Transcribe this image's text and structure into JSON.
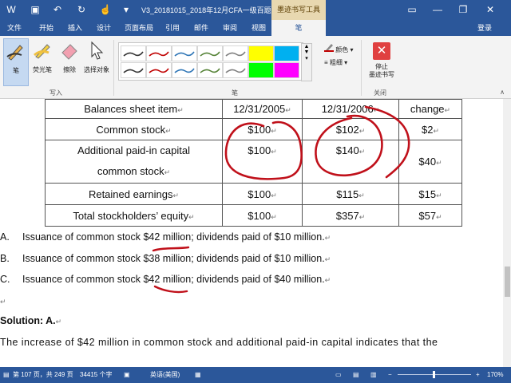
{
  "window": {
    "title": "V3_20181015_2018年12月CFA一级百题预测...",
    "contextual_tab_group": "墨迹书写工具",
    "login": "登录"
  },
  "tabs": [
    {
      "label": "文件"
    },
    {
      "label": "开始"
    },
    {
      "label": "插入"
    },
    {
      "label": "设计"
    },
    {
      "label": "页面布局"
    },
    {
      "label": "引用"
    },
    {
      "label": "邮件"
    },
    {
      "label": "审阅"
    },
    {
      "label": "视图"
    },
    {
      "label": "笔"
    }
  ],
  "ribbon": {
    "write_group": {
      "label": "写入",
      "buttons": [
        {
          "label": "笔"
        },
        {
          "label": "荧光笔"
        },
        {
          "label": "擦除"
        },
        {
          "label": "选择对象"
        }
      ]
    },
    "pens_group": {
      "label": "笔",
      "color_label": "颜色",
      "thickness_label": "粗细"
    },
    "close_group": {
      "label": "关闭",
      "stop_label": "停止\n墨迹书写"
    },
    "pen_colors": [
      "#333333",
      "#c00000",
      "#2e75b6",
      "#548235",
      "#7f7f7f",
      "#ffff00",
      "#00b0f0",
      "#333333",
      "#c00000",
      "#2e75b6",
      "#548235",
      "#7f7f7f",
      "#00ff00",
      "#ff00ff"
    ]
  },
  "table": {
    "header": [
      "Balances sheet item",
      "12/31/2005",
      "12/31/2006",
      "change"
    ],
    "rows": [
      {
        "item": "Common stock",
        "v2005": "$100",
        "v2006": "$102",
        "change": "$2"
      },
      {
        "item1": "Additional paid-in capital",
        "item2": "common stock",
        "v2005": "$100",
        "v2006": "$140",
        "change": "$40"
      },
      {
        "item": "Retained earnings",
        "v2005": "$100",
        "v2006": "$115",
        "change": "$15"
      },
      {
        "item": "Total stockholders’ equity",
        "v2005": "$100",
        "v2006": "$357",
        "change": "$57"
      }
    ]
  },
  "options": [
    {
      "letter": "A.",
      "text": "Issuance of common stock $42 million; dividends paid of $10 million."
    },
    {
      "letter": "B.",
      "text": "Issuance of common stock $38 million; dividends paid of $10 million."
    },
    {
      "letter": "C.",
      "text": "Issuance of common stock $42 million; dividends paid of $40 million."
    }
  ],
  "solution": {
    "heading": "Solution: A.",
    "text": "The increase of $42 million in common stock and additional paid-in capital indicates that the"
  },
  "status": {
    "page": "第 107 页，共 249 页",
    "words": "34415 个字",
    "language": "英语(美国)",
    "zoom": "170%"
  },
  "ink_color": "#c0101a"
}
